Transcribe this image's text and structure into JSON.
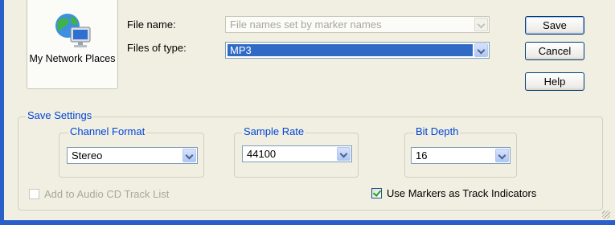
{
  "places": {
    "label": "My Network Places"
  },
  "file_name": {
    "label": "File name:",
    "value": "File names set by marker names"
  },
  "file_type": {
    "label": "Files of type:",
    "value": "MP3"
  },
  "buttons": {
    "save": "Save",
    "cancel": "Cancel",
    "help": "Help"
  },
  "save_settings": {
    "title": "Save Settings",
    "channel_format": {
      "label": "Channel Format",
      "value": "Stereo"
    },
    "sample_rate": {
      "label": "Sample Rate",
      "value": "44100"
    },
    "bit_depth": {
      "label": "Bit Depth",
      "value": "16"
    }
  },
  "options": {
    "add_to_cd": {
      "label": "Add to Audio CD Track List",
      "checked": false,
      "enabled": false
    },
    "use_markers": {
      "label": "Use Markers as Track Indicators",
      "checked": true,
      "enabled": true
    }
  },
  "colors": {
    "selection": "#316ac5",
    "group_title": "#0046d5",
    "window_frame": "#2a5ec8"
  }
}
